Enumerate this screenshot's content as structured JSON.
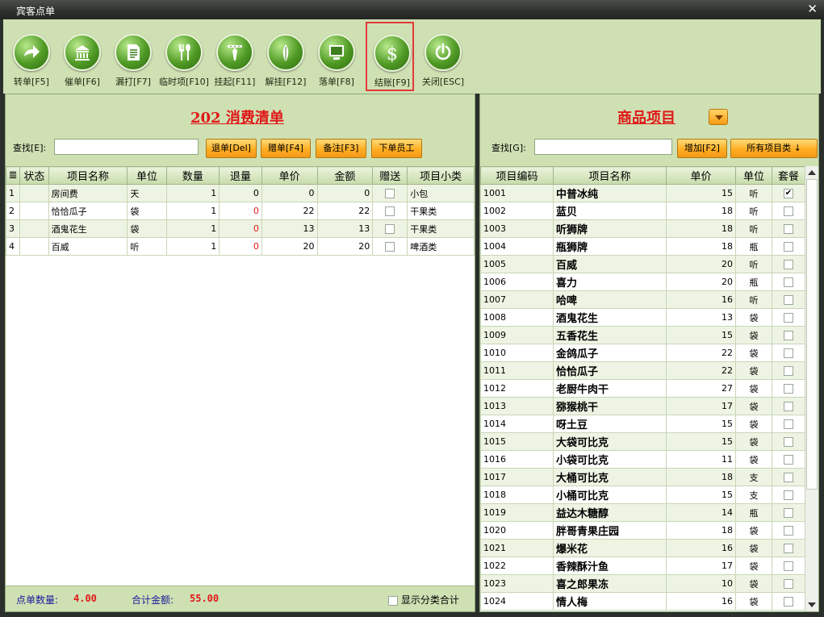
{
  "window": {
    "title": "宾客点单",
    "close_glyph": "✕"
  },
  "toolbar": [
    {
      "label": "转单[F5]",
      "icon": "forward-arrow-icon"
    },
    {
      "label": "催单[F6]",
      "icon": "building-icon"
    },
    {
      "label": "漏打[F7]",
      "icon": "document-icon"
    },
    {
      "label": "临时项[F10]",
      "icon": "fork-spoon-icon"
    },
    {
      "label": "挂起[F11]",
      "icon": "hanger-icon"
    },
    {
      "label": "解挂[F12]",
      "icon": "leaf-icon"
    },
    {
      "label": "落单[F8]",
      "icon": "monitor-icon"
    },
    {
      "label": "结账[F9]",
      "icon": "dollar-icon",
      "selected": true
    },
    {
      "label": "关闭[ESC]",
      "icon": "power-icon"
    }
  ],
  "order": {
    "title": "202  消费清单",
    "search_label": "查找[E]:",
    "search_value": "",
    "buttons": [
      "退单[Del]",
      "赠单[F4]",
      "备注[F3]",
      "下单员工"
    ],
    "columns": [
      "≣",
      "状态",
      "项目名称",
      "单位",
      "数量",
      "退量",
      "单价",
      "金额",
      "赠送",
      "项目小类"
    ],
    "rows": [
      {
        "no": "1",
        "status": "",
        "name": "房间费",
        "unit": "天",
        "qty": "1",
        "ret": "0",
        "price": "0",
        "amount": "0",
        "gift": false,
        "category": "小包"
      },
      {
        "no": "2",
        "status": "",
        "name": "恰恰瓜子",
        "unit": "袋",
        "qty": "1",
        "ret": "0",
        "price": "22",
        "amount": "22",
        "gift": false,
        "category": "干果类"
      },
      {
        "no": "3",
        "status": "",
        "name": "酒鬼花生",
        "unit": "袋",
        "qty": "1",
        "ret": "0",
        "price": "13",
        "amount": "13",
        "gift": false,
        "category": "干果类"
      },
      {
        "no": "4",
        "status": "",
        "name": "百威",
        "unit": "听",
        "qty": "1",
        "ret": "0",
        "price": "20",
        "amount": "20",
        "gift": false,
        "category": "啤酒类"
      }
    ],
    "footer": {
      "count_label": "点单数量:",
      "count_value": "4.00",
      "total_label": "合计金额:",
      "total_value": "55.00",
      "show_category_label": "显示分类合计",
      "show_category_checked": false
    }
  },
  "products": {
    "title": "商品项目",
    "search_label": "查找[G]:",
    "search_value": "",
    "add_button": "增加[F2]",
    "category_button": "所有项目类 ↓",
    "columns": [
      "项目编码",
      "项目名称",
      "单价",
      "单位",
      "套餐"
    ],
    "rows": [
      {
        "code": "1001",
        "name": "中普冰纯",
        "price": "15",
        "unit": "听",
        "combo": true
      },
      {
        "code": "1002",
        "name": "蓝贝",
        "price": "18",
        "unit": "听",
        "combo": false
      },
      {
        "code": "1003",
        "name": "听狮牌",
        "price": "18",
        "unit": "听",
        "combo": false
      },
      {
        "code": "1004",
        "name": "瓶狮牌",
        "price": "18",
        "unit": "瓶",
        "combo": false
      },
      {
        "code": "1005",
        "name": "百威",
        "price": "20",
        "unit": "听",
        "combo": false
      },
      {
        "code": "1006",
        "name": "喜力",
        "price": "20",
        "unit": "瓶",
        "combo": false
      },
      {
        "code": "1007",
        "name": "哈啤",
        "price": "16",
        "unit": "听",
        "combo": false
      },
      {
        "code": "1008",
        "name": "酒鬼花生",
        "price": "13",
        "unit": "袋",
        "combo": false
      },
      {
        "code": "1009",
        "name": "五香花生",
        "price": "15",
        "unit": "袋",
        "combo": false
      },
      {
        "code": "1010",
        "name": "金鸽瓜子",
        "price": "22",
        "unit": "袋",
        "combo": false
      },
      {
        "code": "1011",
        "name": "恰恰瓜子",
        "price": "22",
        "unit": "袋",
        "combo": false
      },
      {
        "code": "1012",
        "name": "老厨牛肉干",
        "price": "27",
        "unit": "袋",
        "combo": false
      },
      {
        "code": "1013",
        "name": "猕猴桃干",
        "price": "17",
        "unit": "袋",
        "combo": false
      },
      {
        "code": "1014",
        "name": "呀土豆",
        "price": "15",
        "unit": "袋",
        "combo": false
      },
      {
        "code": "1015",
        "name": "大袋可比克",
        "price": "15",
        "unit": "袋",
        "combo": false
      },
      {
        "code": "1016",
        "name": "小袋可比克",
        "price": "11",
        "unit": "袋",
        "combo": false
      },
      {
        "code": "1017",
        "name": "大桶可比克",
        "price": "18",
        "unit": "支",
        "combo": false
      },
      {
        "code": "1018",
        "name": "小桶可比克",
        "price": "15",
        "unit": "支",
        "combo": false
      },
      {
        "code": "1019",
        "name": "益达木糖醇",
        "price": "14",
        "unit": "瓶",
        "combo": false
      },
      {
        "code": "1020",
        "name": "胖哥青果庄园",
        "price": "18",
        "unit": "袋",
        "combo": false
      },
      {
        "code": "1021",
        "name": "爆米花",
        "price": "16",
        "unit": "袋",
        "combo": false
      },
      {
        "code": "1022",
        "name": "香辣酥汁鱼",
        "price": "17",
        "unit": "袋",
        "combo": false
      },
      {
        "code": "1023",
        "name": "喜之郎果冻",
        "price": "10",
        "unit": "袋",
        "combo": false
      },
      {
        "code": "1024",
        "name": "情人梅",
        "price": "16",
        "unit": "袋",
        "combo": false
      }
    ]
  }
}
